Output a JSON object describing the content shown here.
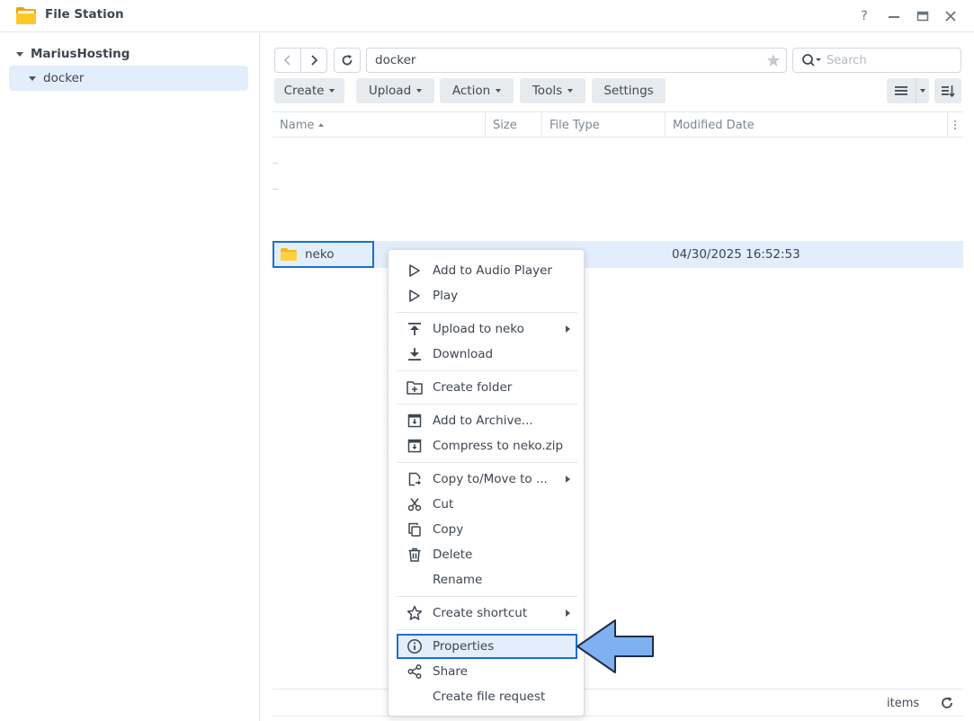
{
  "window": {
    "title": "File Station",
    "help_label": "?"
  },
  "sidebar": {
    "root": "MariusHosting",
    "child": "docker"
  },
  "toolbar": {
    "path": "docker",
    "search_placeholder": "Search",
    "create_label": "Create",
    "upload_label": "Upload",
    "action_label": "Action",
    "tools_label": "Tools",
    "settings_label": "Settings"
  },
  "columns": {
    "name": "Name",
    "size": "Size",
    "type": "File Type",
    "date": "Modified Date"
  },
  "file": {
    "name": "neko",
    "modified": "04/30/2025 16:52:53"
  },
  "context_menu": {
    "add_audio": "Add to Audio Player",
    "play": "Play",
    "upload_to": "Upload to neko",
    "download": "Download",
    "create_folder": "Create folder",
    "add_archive": "Add to Archive...",
    "compress": "Compress to neko.zip",
    "copy_move": "Copy to/Move to ...",
    "cut": "Cut",
    "copy": "Copy",
    "delete": "Delete",
    "rename": "Rename",
    "create_shortcut": "Create shortcut",
    "properties": "Properties",
    "share": "Share",
    "file_request": "Create file request"
  },
  "status": {
    "items_label": "items"
  },
  "colors": {
    "accent": "#1a6fd4",
    "selection": "#e2eefb",
    "arrow": "#7fb0f0"
  }
}
